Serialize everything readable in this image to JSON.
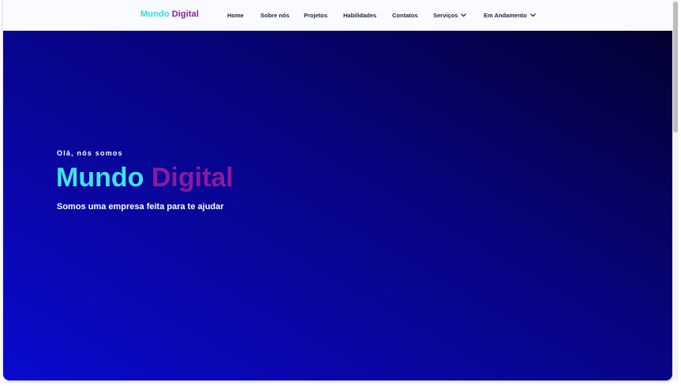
{
  "brand": {
    "first": "Mundo",
    "second": "Digital"
  },
  "nav": {
    "items": [
      {
        "label": "Home"
      },
      {
        "label": "Sobre nós"
      },
      {
        "label": "Projetos"
      },
      {
        "label": "Habilidades"
      },
      {
        "label": "Contatos"
      },
      {
        "label": "Serviços",
        "dropdown": true
      },
      {
        "label": "Em Andamento",
        "dropdown": true
      }
    ]
  },
  "hero": {
    "eyebrow": "Olá, nós somos",
    "title_first": "Mundo",
    "title_second": "Digital",
    "subtitle": "Somos uma empresa feita para te ajudar"
  },
  "colors": {
    "brand_cyan": "#2fd8e6",
    "brand_purple": "#8a16a8",
    "hero_blue": "#0a06a6",
    "nav_text": "#1b2240"
  },
  "icons": {
    "dropdown": "chevron-down-icon"
  }
}
